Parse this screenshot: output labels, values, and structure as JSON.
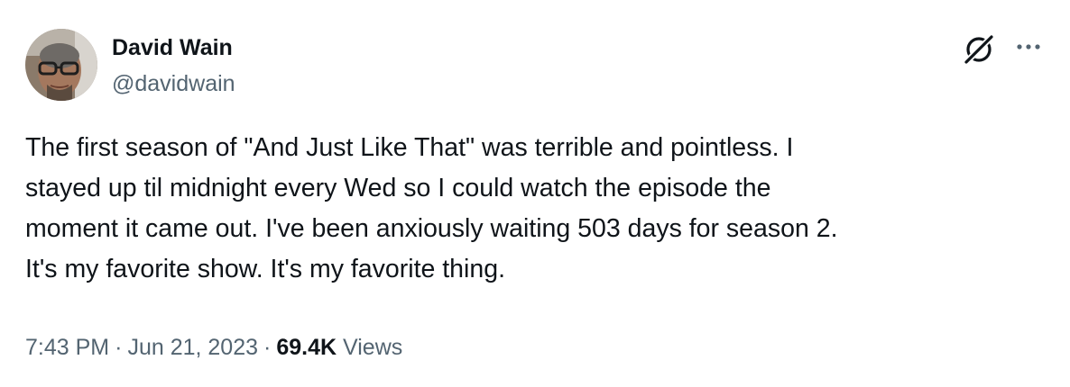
{
  "author": {
    "display_name": "David Wain",
    "handle": "@davidwain",
    "avatar_icon": "user-avatar-photo"
  },
  "actions": {
    "grok_icon": "grok-icon",
    "more_icon": "more-options-icon"
  },
  "tweet": {
    "lines": [
      "The first season of \"And Just Like That\" was terrible and pointless. I",
      "stayed up til midnight every Wed so I could watch the episode the",
      "moment it came out. I've been anxiously waiting 503 days for season 2.",
      "It's my favorite show. It's my favorite thing."
    ]
  },
  "meta": {
    "time": "7:43 PM",
    "separator": "·",
    "date": "Jun 21, 2023",
    "views_count": "69.4K",
    "views_label": "Views"
  },
  "colors": {
    "text_primary": "#0f1419",
    "text_secondary": "#536471",
    "background": "#ffffff"
  }
}
